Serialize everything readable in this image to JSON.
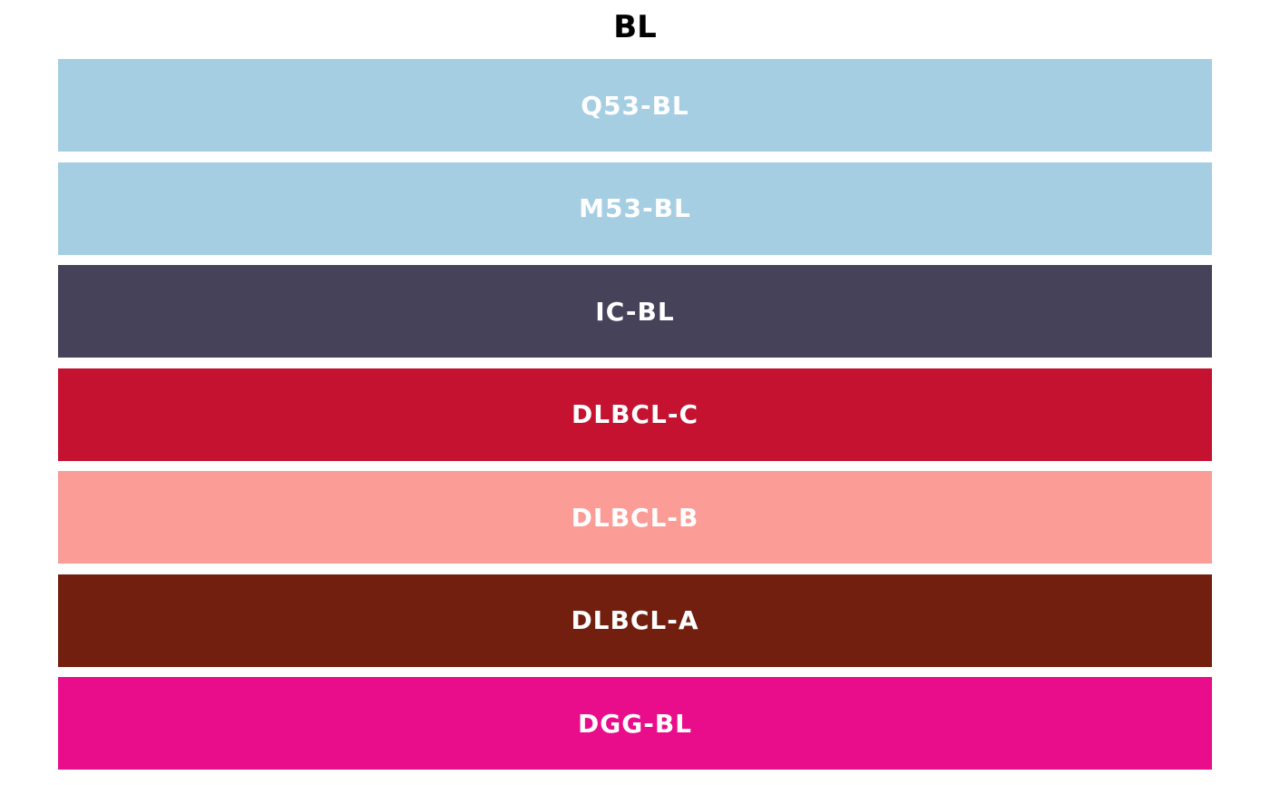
{
  "chart_data": {
    "type": "table",
    "title": "BL",
    "palette": [
      {
        "label": "Q53-BL",
        "color": "#A6CEE3"
      },
      {
        "label": "M53-BL",
        "color": "#A6CEE3"
      },
      {
        "label": "IC-BL",
        "color": "#45425A"
      },
      {
        "label": "DLBCL-C",
        "color": "#C41230"
      },
      {
        "label": "DLBCL-B",
        "color": "#FC9C97"
      },
      {
        "label": "DLBCL-A",
        "color": "#721F0F"
      },
      {
        "label": "DGG-BL",
        "color": "#E90C8B"
      }
    ]
  }
}
